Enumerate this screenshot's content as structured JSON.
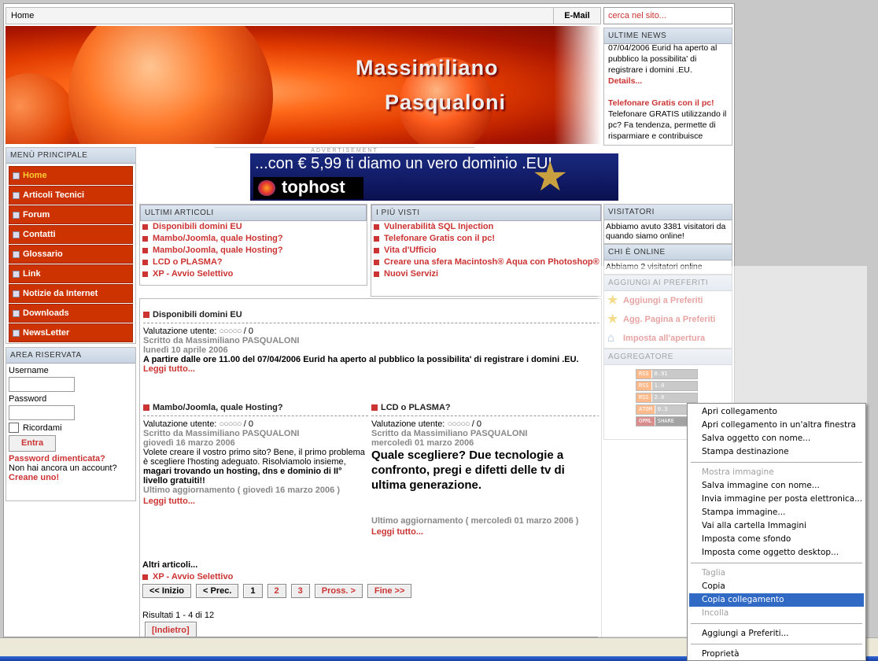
{
  "topbar": {
    "home": "Home",
    "email": "E-Mail",
    "search_placeholder": "cerca nel sito..."
  },
  "banner": {
    "name1": "Massimiliano",
    "name2": "Pasqualoni"
  },
  "ultime_news": {
    "title": "ULTIME NEWS",
    "text1": "07/04/2006 Eurid ha aperto al pubblico la possibilita' di registrare i domini .EU.",
    "details": "Details...",
    "title2": "Telefonare Gratis con il pc!",
    "text2": "Telefonare GRATIS utilizzando il pc? Fa tendenza, permette di risparmiare e contribuisce"
  },
  "menu": {
    "title": "MENÙ PRINCIPALE",
    "items": [
      "Home",
      "Articoli Tecnici",
      "Forum",
      "Contatti",
      "Glossario",
      "Link",
      "Notizie da Internet",
      "Downloads",
      "NewsLetter"
    ]
  },
  "area": {
    "title": "AREA RISERVATA",
    "username": "Username",
    "password": "Password",
    "remember": "Ricordami",
    "login": "Entra",
    "forgot": "Password dimenticata?",
    "noaccount": "Non hai ancora un account?",
    "create": "Creane uno!"
  },
  "ad": {
    "label": "ADVERTISEMENT",
    "text": "...con € 5,99 ti diamo un vero dominio .EU!",
    "brand": "tophost"
  },
  "ultimi_articoli": {
    "title": "ULTIMI ARTICOLI",
    "items": [
      "Disponibili domini EU",
      "Mambo/Joomla, quale Hosting?",
      "Mambo/Joomla, quale Hosting?",
      "LCD o PLASMA?",
      "XP - Avvio Selettivo"
    ]
  },
  "piu_visti": {
    "title": "I PIÙ VISTI",
    "items": [
      "Vulnerabilità SQL Injection",
      "Telefonare Gratis con il pc!",
      "Vita d'Ufficio",
      "Creare una sfera Macintosh® Aqua con Photoshop®",
      "Nuovi Servizi"
    ]
  },
  "article1": {
    "title": "Disponibili domini EU",
    "rating": "Valutazione utente:",
    "rating_dots": "○○○○○",
    "rating_val": "/ 0",
    "author": "Scritto da Massimiliano PASQUALONI",
    "date": "lunedì 10 aprile 2006",
    "body": "A partire dalle ore 11.00 del 07/04/2006 Eurid ha aperto al pubblico la possibilita' di registrare i domini .EU.",
    "more": "Leggi tutto..."
  },
  "article2": {
    "title": "Mambo/Joomla, quale Hosting?",
    "rating": "Valutazione utente:",
    "rating_dots": "○○○○○",
    "rating_val": "/ 0",
    "author": "Scritto da Massimiliano PASQUALONI",
    "date": "giovedì 16 marzo 2006",
    "body1": "Volete creare il vostro primo sito? Bene, il primo problema è scegliere l'hosting adeguato. Risolviamolo insieme,",
    "body2": "magari trovando un hosting, dns e dominio di II° livello gratuiti!!",
    "updated": "Ultimo aggiornamento ( giovedì 16 marzo 2006 )",
    "more": "Leggi tutto..."
  },
  "article3": {
    "title": "LCD o PLASMA?",
    "rating": "Valutazione utente:",
    "rating_dots": "○○○○○",
    "rating_val": "/ 0",
    "author": "Scritto da Massimiliano PASQUALONI",
    "date": "mercoledì 01 marzo 2006",
    "body": "Quale scegliere? Due tecnologie a confronto, pregi e difetti delle tv di ultima generazione.",
    "updated": "Ultimo aggiornamento ( mercoledì 01 marzo 2006 )",
    "more": "Leggi tutto..."
  },
  "altri": {
    "title": "Altri articoli...",
    "item": "XP - Avvio Selettivo"
  },
  "pager": {
    "start": "<< Inizio",
    "prev": "< Prec.",
    "p1": "1",
    "p2": "2",
    "p3": "3",
    "next": "Pross. >",
    "end": "Fine >>"
  },
  "results": "Risultati 1 - 4 di 12",
  "back": "[Indietro]",
  "visitatori": {
    "title": "VISITATORI",
    "text": "Abbiamo avuto 3381 visitatori da quando siamo online!"
  },
  "chi_online": {
    "title": "CHI È ONLINE",
    "text": "Abbiamo 2 visitatori online"
  },
  "preferiti": {
    "title": "AGGIUNGI AI PREFERITI",
    "items": [
      "Aggiungi a Preferiti",
      "Agg. Pagina a Preferiti",
      "Imposta all'apertura"
    ]
  },
  "aggregatore": {
    "title": "AGGREGATORE",
    "feeds": [
      [
        "RSS",
        "0.91"
      ],
      [
        "RSS",
        "1.0"
      ],
      [
        "RSS",
        "2.0"
      ],
      [
        "ATOM",
        "0.3"
      ],
      [
        "OPML",
        "SHARE"
      ]
    ]
  },
  "context_menu": {
    "items": [
      {
        "label": "Apri collegamento",
        "state": "normal"
      },
      {
        "label": "Apri collegamento in un'altra finestra",
        "state": "normal"
      },
      {
        "label": "Salva oggetto con nome...",
        "state": "normal"
      },
      {
        "label": "Stampa destinazione",
        "state": "normal"
      },
      {
        "sep": true
      },
      {
        "label": "Mostra immagine",
        "state": "disabled"
      },
      {
        "label": "Salva immagine con nome...",
        "state": "normal"
      },
      {
        "label": "Invia immagine per posta elettronica...",
        "state": "normal"
      },
      {
        "label": "Stampa immagine...",
        "state": "normal"
      },
      {
        "label": "Vai alla cartella Immagini",
        "state": "normal"
      },
      {
        "label": "Imposta come sfondo",
        "state": "normal"
      },
      {
        "label": "Imposta come oggetto desktop...",
        "state": "normal"
      },
      {
        "sep": true
      },
      {
        "label": "Taglia",
        "state": "disabled"
      },
      {
        "label": "Copia",
        "state": "normal"
      },
      {
        "label": "Copia collegamento",
        "state": "selected"
      },
      {
        "label": "Incolla",
        "state": "disabled"
      },
      {
        "sep": true
      },
      {
        "label": "Aggiungi a Preferiti...",
        "state": "normal"
      },
      {
        "sep": true
      },
      {
        "label": "Proprietà",
        "state": "normal"
      }
    ]
  },
  "colors": {
    "accent": "#cc3300",
    "link": "#cc3333",
    "menu_selected": "#316ac5"
  }
}
